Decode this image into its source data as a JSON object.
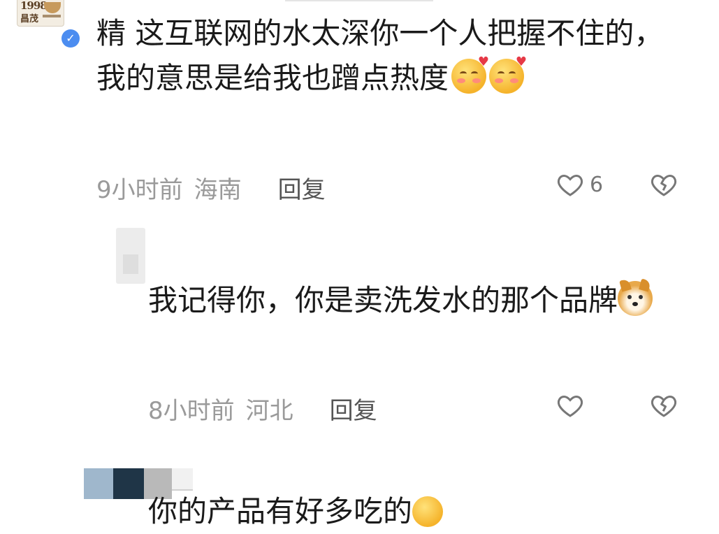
{
  "top_comment": {
    "avatar_brand": "1998",
    "avatar_brand_sub": "昌茂",
    "badge": "精",
    "text": "这互联网的水太深你一个人把握不住的，我的意思是给我也蹭点热度",
    "emojis": [
      "smiling-face-with-hearts",
      "smiling-face-with-hearts"
    ],
    "time": "9小时前",
    "location": "海南",
    "reply_label": "回复",
    "likes": "6"
  },
  "reply_1": {
    "text": "我记得你，你是卖洗发水的那个品牌",
    "emoji": "doge",
    "time": "8小时前",
    "location": "河北",
    "reply_label": "回复"
  },
  "reply_2": {
    "text": "你的产品有好多吃的",
    "emoji": "face-emoji"
  },
  "colors": {
    "verified": "#4c8df0",
    "meta_text": "#9a9a9a",
    "icon": "#777777"
  }
}
